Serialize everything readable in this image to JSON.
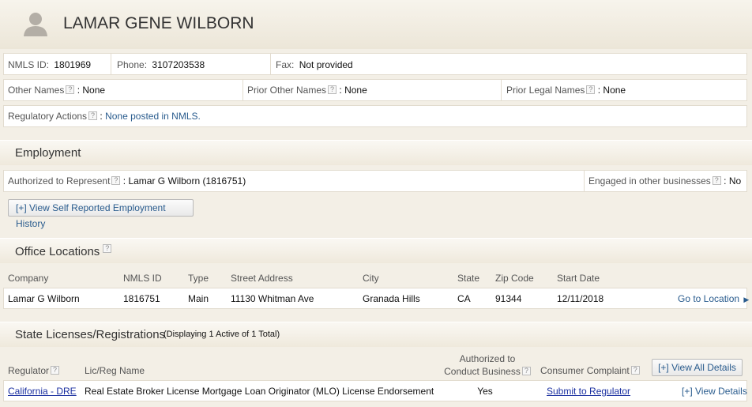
{
  "header": {
    "name": "LAMAR GENE WILBORN"
  },
  "summary": {
    "nmls_label": "NMLS ID:",
    "nmls_value": "1801969",
    "phone_label": "Phone:",
    "phone_value": "3107203538",
    "fax_label": "Fax:",
    "fax_value": "Not provided",
    "other_names_label": "Other Names",
    "other_names_value": "None",
    "prior_other_label": "Prior Other Names",
    "prior_other_value": "None",
    "prior_legal_label": "Prior Legal Names",
    "prior_legal_value": "None",
    "reg_label": "Regulatory Actions",
    "reg_value": "None posted in NMLS.",
    "help": "?",
    "colon": ":"
  },
  "employment": {
    "title": "Employment",
    "auth_label": "Authorized to Represent",
    "auth_value": "Lamar G Wilborn (1816751)",
    "engaged_label": "Engaged in other businesses",
    "engaged_value": "No",
    "history_button": "[+] View Self Reported Employment History"
  },
  "offices": {
    "title": "Office Locations",
    "headers": {
      "company": "Company",
      "nmls": "NMLS ID",
      "type": "Type",
      "street": "Street Address",
      "city": "City",
      "state": "State",
      "zip": "Zip Code",
      "start": "Start Date"
    },
    "row": {
      "company": "Lamar G Wilborn",
      "nmls": "1816751",
      "type": "Main",
      "street": "11130 Whitman Ave",
      "city": "Granada Hills",
      "state": "CA",
      "zip": "91344",
      "start": "12/11/2018",
      "go": "Go to Location"
    }
  },
  "licenses": {
    "title": "State Licenses/Registrations",
    "subtitle": "(Displaying 1 Active of 1 Total)",
    "headers": {
      "regulator": "Regulator",
      "lic": "Lic/Reg Name",
      "auth_line1": "Authorized to",
      "auth_line2": "Conduct Business",
      "complaint": "Consumer Complaint"
    },
    "view_all_button": "[+] View All Details",
    "row": {
      "regulator": "California - DRE",
      "lic": "Real Estate Broker License Mortgage Loan Originator (MLO) License Endorsement",
      "auth": "Yes",
      "complaint": "Submit to Regulator",
      "details": "[+] View Details"
    }
  }
}
